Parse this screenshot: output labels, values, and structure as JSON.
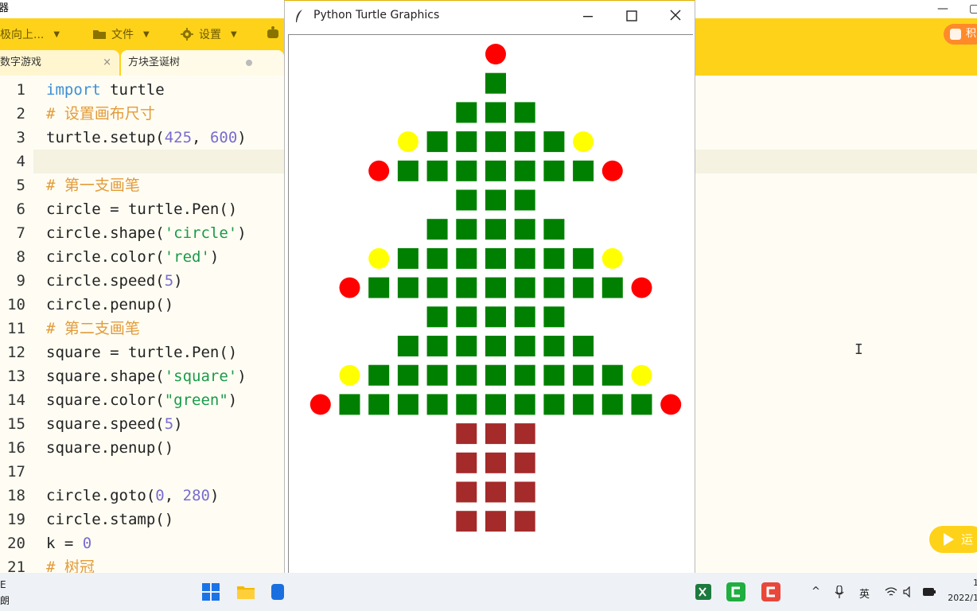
{
  "app": {
    "title_fragment": "器",
    "toolbar": {
      "items": [
        {
          "label": "极向上...",
          "icon": "direction-icon"
        },
        {
          "label": "文件",
          "icon": "folder-icon"
        },
        {
          "label": "设置",
          "icon": "gear-icon"
        }
      ],
      "points_label": "积"
    },
    "tabs": [
      {
        "label": "数字游戏",
        "close": "×"
      },
      {
        "label": "方块圣诞树"
      }
    ],
    "run_label": "运"
  },
  "editor": {
    "lines": [
      {
        "n": "1",
        "tokens": [
          [
            "kw",
            "import"
          ],
          [
            "t",
            " turtle"
          ]
        ]
      },
      {
        "n": "2",
        "tokens": [
          [
            "cm",
            "# 设置画布尺寸"
          ]
        ]
      },
      {
        "n": "3",
        "tokens": [
          [
            "t",
            "turtle.setup("
          ],
          [
            "num",
            "425"
          ],
          [
            "t",
            ", "
          ],
          [
            "num",
            "600"
          ],
          [
            "t",
            ")"
          ]
        ]
      },
      {
        "n": "4",
        "tokens": []
      },
      {
        "n": "5",
        "tokens": [
          [
            "cm",
            "# 第一支画笔"
          ]
        ]
      },
      {
        "n": "6",
        "tokens": [
          [
            "t",
            "circle = turtle.Pen()"
          ]
        ]
      },
      {
        "n": "7",
        "tokens": [
          [
            "t",
            "circle.shape("
          ],
          [
            "str",
            "'circle'"
          ],
          [
            "t",
            ")"
          ]
        ]
      },
      {
        "n": "8",
        "tokens": [
          [
            "t",
            "circle.color("
          ],
          [
            "str",
            "'red'"
          ],
          [
            "t",
            ")"
          ]
        ]
      },
      {
        "n": "9",
        "tokens": [
          [
            "t",
            "circle.speed("
          ],
          [
            "num",
            "5"
          ],
          [
            "t",
            ")"
          ]
        ]
      },
      {
        "n": "10",
        "tokens": [
          [
            "t",
            "circle.penup()"
          ]
        ]
      },
      {
        "n": "11",
        "tokens": [
          [
            "cm",
            "# 第二支画笔"
          ]
        ]
      },
      {
        "n": "12",
        "tokens": [
          [
            "t",
            "square = turtle.Pen()"
          ]
        ]
      },
      {
        "n": "13",
        "tokens": [
          [
            "t",
            "square.shape("
          ],
          [
            "str",
            "'square'"
          ],
          [
            "t",
            ")"
          ]
        ]
      },
      {
        "n": "14",
        "tokens": [
          [
            "t",
            "square.color("
          ],
          [
            "str",
            "\"green\""
          ],
          [
            "t",
            ")"
          ]
        ]
      },
      {
        "n": "15",
        "tokens": [
          [
            "t",
            "square.speed("
          ],
          [
            "num",
            "5"
          ],
          [
            "t",
            ")"
          ]
        ]
      },
      {
        "n": "16",
        "tokens": [
          [
            "t",
            "square.penup()"
          ]
        ]
      },
      {
        "n": "17",
        "tokens": []
      },
      {
        "n": "18",
        "tokens": [
          [
            "t",
            "circle.goto("
          ],
          [
            "num",
            "0"
          ],
          [
            "t",
            ", "
          ],
          [
            "num",
            "280"
          ],
          [
            "t",
            ")"
          ]
        ]
      },
      {
        "n": "19",
        "tokens": [
          [
            "t",
            "circle.stamp()"
          ]
        ]
      },
      {
        "n": "20",
        "tokens": [
          [
            "t",
            "k = "
          ],
          [
            "num",
            "0"
          ]
        ]
      },
      {
        "n": "21",
        "tokens": [
          [
            "cm",
            "# 树冠"
          ]
        ]
      }
    ]
  },
  "turtle_window": {
    "title": "Python Turtle Graphics",
    "colors": {
      "green": "#008000",
      "red": "#ff0000",
      "yellow": "#ffff00",
      "trunk": "#a52a2a"
    },
    "rows": [
      {
        "row": 0,
        "cells": [
          [
            "R",
            0
          ]
        ]
      },
      {
        "row": 1,
        "cells": [
          [
            "G",
            0
          ]
        ]
      },
      {
        "row": 2,
        "cells": [
          [
            "G",
            -1
          ],
          [
            "G",
            0
          ],
          [
            "G",
            1
          ]
        ]
      },
      {
        "row": 3,
        "cells": [
          [
            "Y",
            -3
          ],
          [
            "G",
            -2
          ],
          [
            "G",
            -1
          ],
          [
            "G",
            0
          ],
          [
            "G",
            1
          ],
          [
            "G",
            2
          ],
          [
            "Y",
            3
          ]
        ]
      },
      {
        "row": 4,
        "cells": [
          [
            "R",
            -4
          ],
          [
            "G",
            -3
          ],
          [
            "G",
            -2
          ],
          [
            "G",
            -1
          ],
          [
            "G",
            0
          ],
          [
            "G",
            1
          ],
          [
            "G",
            2
          ],
          [
            "G",
            3
          ],
          [
            "R",
            4
          ]
        ]
      },
      {
        "row": 5,
        "cells": [
          [
            "G",
            -1
          ],
          [
            "G",
            0
          ],
          [
            "G",
            1
          ]
        ]
      },
      {
        "row": 6,
        "cells": [
          [
            "G",
            -2
          ],
          [
            "G",
            -1
          ],
          [
            "G",
            0
          ],
          [
            "G",
            1
          ],
          [
            "G",
            2
          ]
        ]
      },
      {
        "row": 7,
        "cells": [
          [
            "Y",
            -4
          ],
          [
            "G",
            -3
          ],
          [
            "G",
            -2
          ],
          [
            "G",
            -1
          ],
          [
            "G",
            0
          ],
          [
            "G",
            1
          ],
          [
            "G",
            2
          ],
          [
            "G",
            3
          ],
          [
            "Y",
            4
          ]
        ]
      },
      {
        "row": 8,
        "cells": [
          [
            "R",
            -5
          ],
          [
            "G",
            -4
          ],
          [
            "G",
            -3
          ],
          [
            "G",
            -2
          ],
          [
            "G",
            -1
          ],
          [
            "G",
            0
          ],
          [
            "G",
            1
          ],
          [
            "G",
            2
          ],
          [
            "G",
            3
          ],
          [
            "G",
            4
          ],
          [
            "R",
            5
          ]
        ]
      },
      {
        "row": 9,
        "cells": [
          [
            "G",
            -2
          ],
          [
            "G",
            -1
          ],
          [
            "G",
            0
          ],
          [
            "G",
            1
          ],
          [
            "G",
            2
          ]
        ]
      },
      {
        "row": 10,
        "cells": [
          [
            "G",
            -3
          ],
          [
            "G",
            -2
          ],
          [
            "G",
            -1
          ],
          [
            "G",
            0
          ],
          [
            "G",
            1
          ],
          [
            "G",
            2
          ],
          [
            "G",
            3
          ]
        ]
      },
      {
        "row": 11,
        "cells": [
          [
            "Y",
            -5
          ],
          [
            "G",
            -4
          ],
          [
            "G",
            -3
          ],
          [
            "G",
            -2
          ],
          [
            "G",
            -1
          ],
          [
            "G",
            0
          ],
          [
            "G",
            1
          ],
          [
            "G",
            2
          ],
          [
            "G",
            3
          ],
          [
            "G",
            4
          ],
          [
            "Y",
            5
          ]
        ]
      },
      {
        "row": 12,
        "cells": [
          [
            "R",
            -6
          ],
          [
            "G",
            -5
          ],
          [
            "G",
            -4
          ],
          [
            "G",
            -3
          ],
          [
            "G",
            -2
          ],
          [
            "G",
            -1
          ],
          [
            "G",
            0
          ],
          [
            "G",
            1
          ],
          [
            "G",
            2
          ],
          [
            "G",
            3
          ],
          [
            "G",
            4
          ],
          [
            "G",
            5
          ],
          [
            "R",
            6
          ]
        ]
      },
      {
        "row": 13,
        "cells": [
          [
            "T",
            -1
          ],
          [
            "T",
            0
          ],
          [
            "T",
            1
          ]
        ]
      },
      {
        "row": 14,
        "cells": [
          [
            "T",
            -1
          ],
          [
            "T",
            0
          ],
          [
            "T",
            1
          ]
        ]
      },
      {
        "row": 15,
        "cells": [
          [
            "T",
            -1
          ],
          [
            "T",
            0
          ],
          [
            "T",
            1
          ]
        ]
      },
      {
        "row": 16,
        "cells": [
          [
            "T",
            -1
          ],
          [
            "T",
            0
          ],
          [
            "T",
            1
          ]
        ]
      }
    ]
  },
  "taskbar": {
    "left_text_1": "E",
    "left_text_2": "朗",
    "ime": "英",
    "clock_line1": "1",
    "clock_line2": "2022/1"
  }
}
